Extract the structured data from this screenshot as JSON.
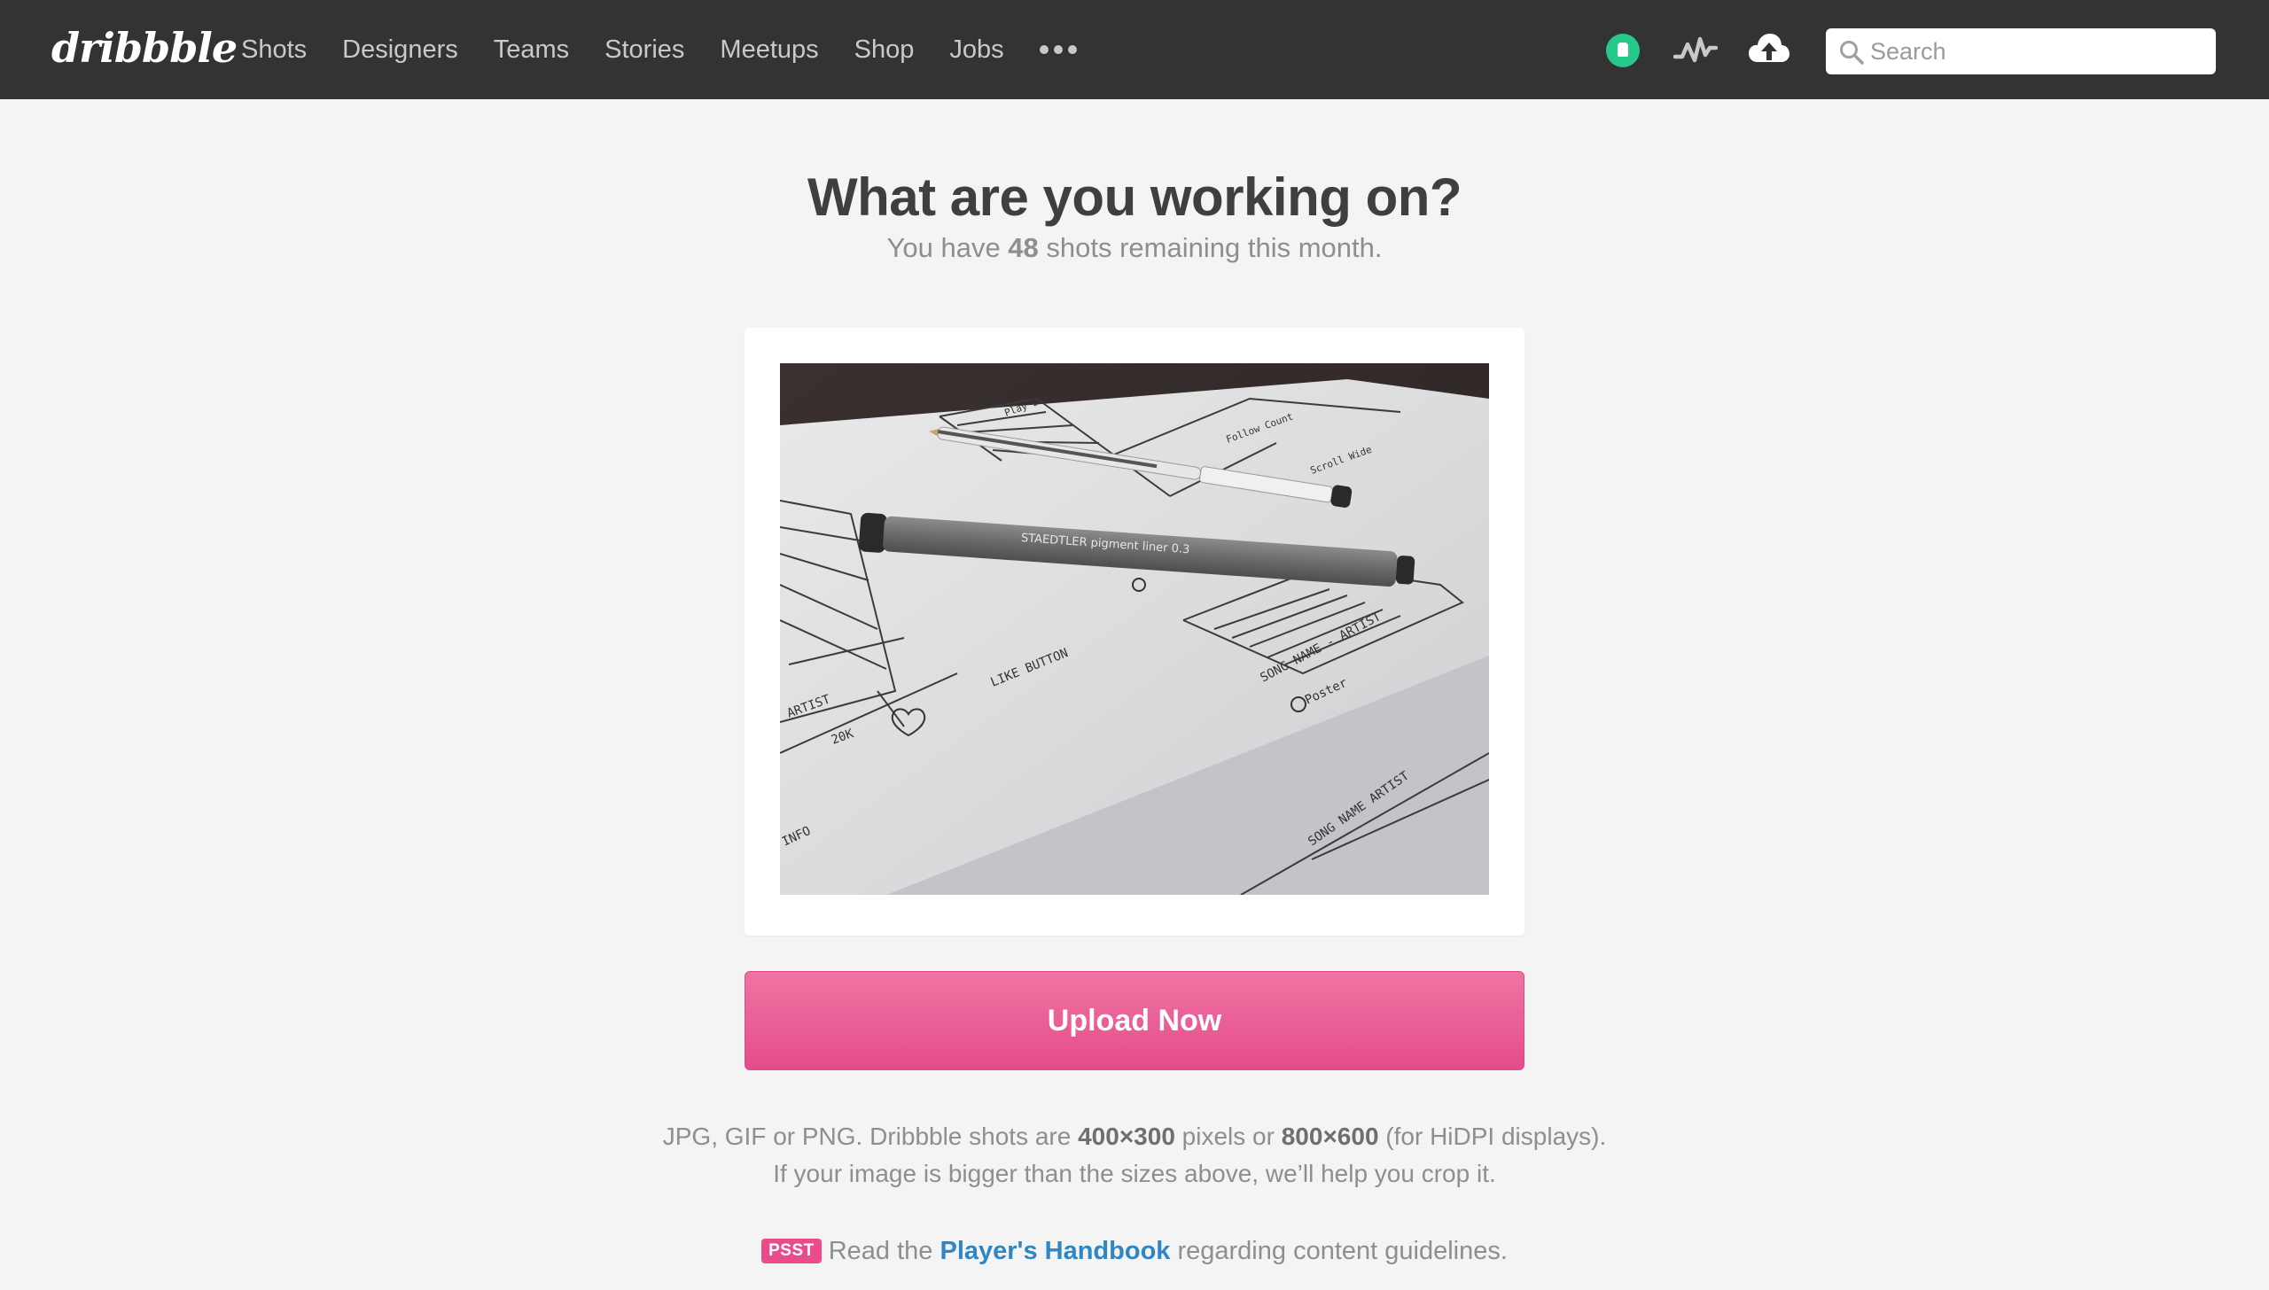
{
  "brand": {
    "logo_text": "dribbble",
    "accent_color": "#ea4c89",
    "nav_bg": "#333333"
  },
  "nav": {
    "items": [
      {
        "label": "Shots"
      },
      {
        "label": "Designers"
      },
      {
        "label": "Teams"
      },
      {
        "label": "Stories"
      },
      {
        "label": "Meetups"
      },
      {
        "label": "Shop"
      },
      {
        "label": "Jobs"
      }
    ],
    "more_icon": "ellipsis-icon"
  },
  "header_icons": {
    "pro_badge": "pro-badge-icon",
    "activity": "activity-icon",
    "upload": "cloud-upload-icon"
  },
  "search": {
    "placeholder": "Search",
    "value": ""
  },
  "main": {
    "heading": "What are you working on?",
    "sub_prefix": "You have ",
    "shots_remaining": "48",
    "sub_suffix": " shots remaining this month.",
    "upload_label": "Upload Now",
    "info_line1_prefix": "JPG, GIF or PNG. Dribbble shots are ",
    "size_standard": "400×300",
    "info_line1_mid": " pixels or ",
    "size_hidpi": "800×600",
    "info_line1_suffix": " (for HiDPI displays).",
    "info_line2": "If your image is bigger than the sizes above, we’ll help you crop it.",
    "psst_badge": "PSST",
    "psst_prefix": "Read the ",
    "handbook_link": "Player's Handbook",
    "psst_suffix": " regarding content guidelines.",
    "photo_handwriting": [
      "LIKE BUTTON",
      "ARTIST",
      "20K",
      "INFO",
      "SONG NAME - ARTIST",
      "SONG NAME ARTIST",
      "Poster",
      "Play Button",
      "Follow Count",
      "Scroll Wide"
    ],
    "photo_pen_text": "STAEDTLER pigment liner 0.3"
  }
}
